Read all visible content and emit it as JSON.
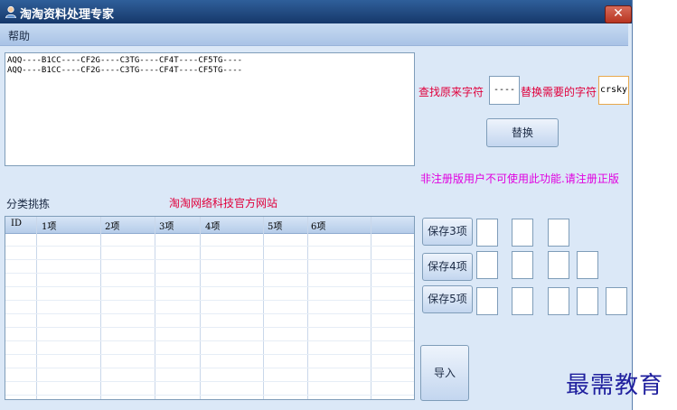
{
  "window": {
    "title": "淘淘资料处理专家",
    "close_label": "✕"
  },
  "menu": {
    "help": "帮助"
  },
  "textarea": {
    "lines": [
      "AQQ----B1CC----CF2G----C3TG----CF4T----CF5TG----",
      "AQQ----B1CC----CF2G----C3TG----CF4T----CF5TG----"
    ]
  },
  "replace": {
    "find_label": "查找原来字符",
    "find_value": "----",
    "replace_label": "替换需要的字符",
    "replace_value": "crsky",
    "button": "替换"
  },
  "warning": "非注册版用户不可使用此功能.请注册正版",
  "category": {
    "label": "分类挑拣",
    "site_link": "淘淘网络科技官方网站"
  },
  "grid": {
    "columns": [
      "ID",
      "1项",
      "2项",
      "3项",
      "4项",
      "5项",
      "6项"
    ]
  },
  "save_buttons": {
    "save3": "保存3项",
    "save4": "保存4项",
    "save5": "保存5项"
  },
  "import_button": "导入",
  "watermark": "最需教育",
  "colors": {
    "accent_red": "#e0003c",
    "warning_magenta": "#e000e0",
    "title_bar": "#1f4a85",
    "panel_bg": "#dbe8f7"
  }
}
